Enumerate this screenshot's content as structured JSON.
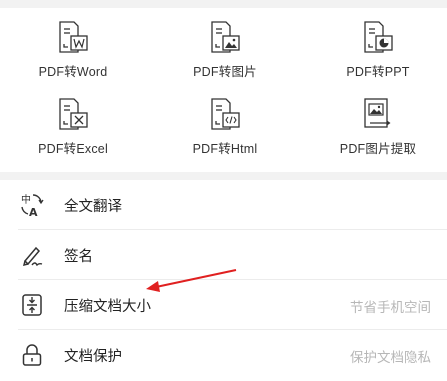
{
  "tools": [
    {
      "label": "PDF转Word",
      "icon": "pdf-to-word-icon"
    },
    {
      "label": "PDF转图片",
      "icon": "pdf-to-image-icon"
    },
    {
      "label": "PDF转PPT",
      "icon": "pdf-to-ppt-icon"
    },
    {
      "label": "PDF转Excel",
      "icon": "pdf-to-excel-icon"
    },
    {
      "label": "PDF转Html",
      "icon": "pdf-to-html-icon"
    },
    {
      "label": "PDF图片提取",
      "icon": "pdf-image-extract-icon"
    }
  ],
  "list": [
    {
      "label": "全文翻译",
      "sub": "",
      "icon": "translate-icon"
    },
    {
      "label": "签名",
      "sub": "",
      "icon": "signature-icon"
    },
    {
      "label": "压缩文档大小",
      "sub": "节省手机空间",
      "icon": "compress-icon"
    },
    {
      "label": "文档保护",
      "sub": "保护文档隐私",
      "icon": "lock-icon"
    }
  ],
  "colors": {
    "annotation_arrow": "#e02020",
    "icon_stroke": "#333333",
    "subtext": "#b7b7b7"
  }
}
